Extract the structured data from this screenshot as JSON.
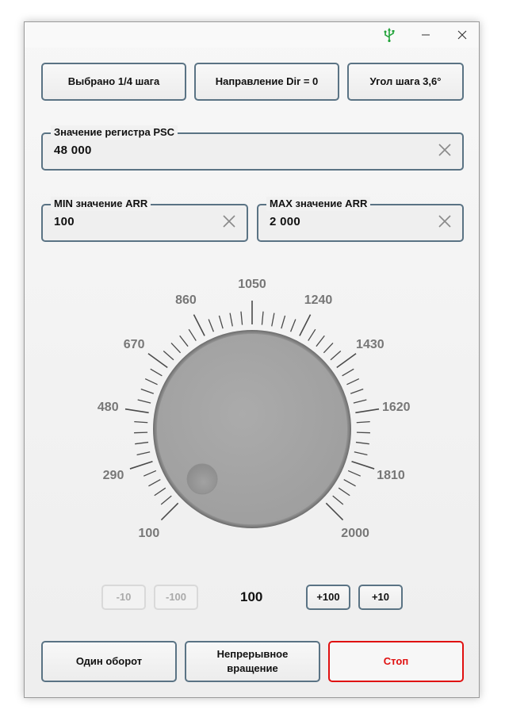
{
  "titlebar": {
    "usb_icon": "usb-icon",
    "minimize_label": "—",
    "close_label": "✕"
  },
  "top_buttons": {
    "step": "Выбрано 1/4 шага",
    "direction": "Направление Dir = 0",
    "angle": "Угол шага 3,6°"
  },
  "psc": {
    "label": "Значение регистра PSC",
    "value": "48 000"
  },
  "arr_min": {
    "label": "MIN значение ARR",
    "value": "100"
  },
  "arr_max": {
    "label": "MAX значение ARR",
    "value": "2 000"
  },
  "dial": {
    "scale_labels": [
      "100",
      "290",
      "480",
      "670",
      "860",
      "1050",
      "1240",
      "1430",
      "1620",
      "1810",
      "2000"
    ],
    "min": 100,
    "max": 2000,
    "value": 100,
    "knob_color": "#a6a6a6",
    "label_color": "#777777"
  },
  "stepper": {
    "minus10": "-10",
    "minus100": "-100",
    "value": "100",
    "plus100": "+100",
    "plus10": "+10"
  },
  "bottom_buttons": {
    "one_turn": "Один оборот",
    "continuous": "Непрерывное вращение",
    "stop": "Стоп"
  },
  "colors": {
    "accent_border": "#5a7384",
    "stop": "#e01010",
    "usb_green": "#22a33a"
  }
}
